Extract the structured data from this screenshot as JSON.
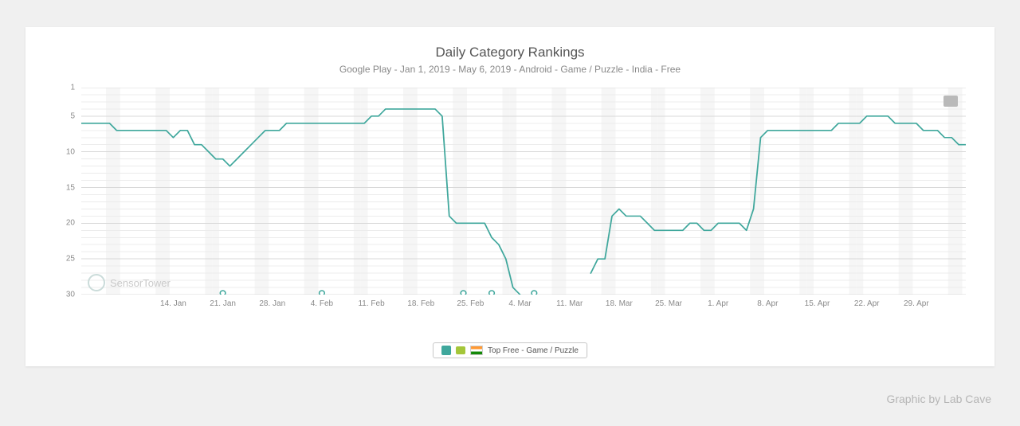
{
  "title": "Daily Category Rankings",
  "subtitle": "Google Play - Jan 1, 2019 - May 6, 2019 - Android - Game / Puzzle - India - Free",
  "legend": "Top Free - Game / Puzzle",
  "watermark": "SensorTower",
  "attribution": "Graphic by Lab Cave",
  "colors": {
    "series": "#3fa79c",
    "grid": "#d8d8d8"
  },
  "chart_data": {
    "type": "line",
    "title": "Daily Category Rankings",
    "xlabel": "",
    "ylabel": "",
    "ylim": [
      1,
      30
    ],
    "y_reversed": true,
    "y_ticks": [
      1,
      5,
      10,
      15,
      20,
      25,
      30
    ],
    "x_tick_labels": [
      "14. Jan",
      "21. Jan",
      "28. Jan",
      "4. Feb",
      "11. Feb",
      "18. Feb",
      "25. Feb",
      "4. Mar",
      "11. Mar",
      "18. Mar",
      "25. Mar",
      "1. Apr",
      "8. Apr",
      "15. Apr",
      "22. Apr",
      "29. Apr"
    ],
    "x_tick_indices": [
      13,
      20,
      27,
      34,
      41,
      48,
      55,
      62,
      69,
      76,
      83,
      90,
      97,
      104,
      111,
      118
    ],
    "x_range_days": 126,
    "event_marker_indices": [
      20,
      34,
      54,
      58,
      64
    ],
    "series": [
      {
        "name": "Top Free - Game / Puzzle",
        "segments": [
          {
            "start_index": 0,
            "values": [
              6,
              6,
              6,
              6,
              6,
              7,
              7,
              7,
              7,
              7,
              7,
              7,
              7,
              8,
              7,
              7,
              9,
              9,
              10,
              11,
              11,
              12,
              11,
              10,
              9,
              8,
              7,
              7,
              7,
              6,
              6,
              6,
              6,
              6,
              6,
              6,
              6,
              6,
              6,
              6,
              6,
              5,
              5,
              4,
              4,
              4,
              4,
              4,
              4,
              4,
              4,
              5,
              19,
              20,
              20,
              20,
              20,
              20,
              22,
              23,
              25,
              29,
              30
            ]
          },
          {
            "start_index": 72,
            "values": [
              27,
              25,
              25,
              19,
              18,
              19,
              19,
              19,
              20,
              21,
              21,
              21,
              21,
              21,
              20,
              20,
              21,
              21,
              20,
              20,
              20,
              20,
              21,
              18,
              8,
              7,
              7,
              7,
              7,
              7,
              7,
              7,
              7,
              7,
              7,
              6,
              6,
              6,
              6,
              5,
              5,
              5,
              5,
              6,
              6,
              6,
              6,
              7,
              7,
              7,
              8,
              8,
              9,
              9
            ]
          }
        ]
      }
    ]
  }
}
